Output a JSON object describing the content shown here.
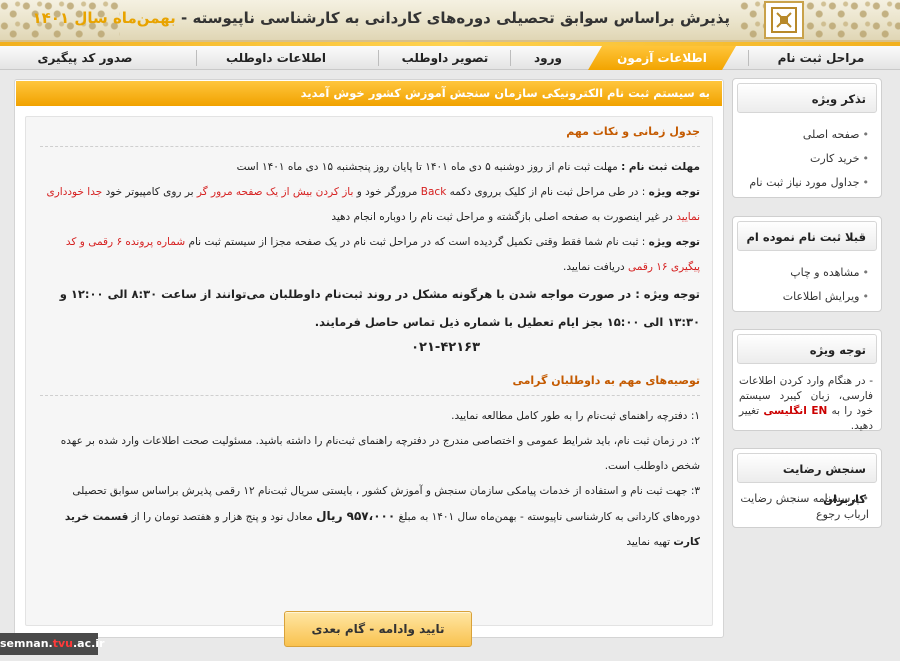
{
  "header": {
    "title": "پذیرش براساس سوابق تحصیلی دوره‌های کاردانی به کارشناسی ناپیوسته - ",
    "title_year": "بهمن‌ماه سال ۱۴۰۱"
  },
  "nav": {
    "items": [
      {
        "label": "مراحل ثبت نام"
      },
      {
        "label": "اطلاعات آزمون"
      },
      {
        "label": "ورود"
      },
      {
        "label": "تصویر داوطلب"
      },
      {
        "label": "اطلاعات داوطلب"
      },
      {
        "label": "صدور کد پیگیری"
      }
    ],
    "active_index": 1
  },
  "main": {
    "welcome": "به سیستم ثبت نام الکترونیکی سازمان سنجش آموزش کشور خوش آمدید",
    "section1_title": "جدول زمانی و نکات مهم",
    "deadline_label": "مهلت ثبت نام :",
    "deadline_text": " مهلت ثبت نام از روز دوشنبه ۵ دی ماه ۱۴۰۱ تا پایان روز پنجشنبه ۱۵ دی ماه ۱۴۰۱ است",
    "note_label": "توجه ویژه",
    "note1_a": " : در طی مراحل ثبت نام از کلیک برروی دکمه ",
    "note1_back": "Back",
    "note1_b": " مرورگر خود و ",
    "note1_red1": "باز کردن بیش از یک صفحه مرور گر",
    "note1_c": " بر روی کامپیوتر خود ",
    "note1_red2": "جدا خودداری نمایید",
    "note1_d": " در غیر اینصورت به صفحه اصلی بازگشته و مراحل ثبت نام را دوباره انجام دهید",
    "note2_a": " : ثبت نام  شما فقط وقتی تکمیل گردیده است که در مراحل ثبت نام در یک صفحه مجزا از سیستم ثبت نام ",
    "note2_red1": "شماره پرونده  ۶ رقمی",
    "note2_b": " ",
    "note2_red2": "و کد پیگیری ۱۶ رقمی",
    "note2_c": " دریافت نمایید.",
    "note3_text": " : در صورت مواجه شدن با هرگونه مشکل در روند ثبت‌نام داوطلبان می‌توانند از ساعت ۸:۳۰ الی ۱۲:۰۰ و ۱۳:۳۰ الی ۱۵:۰۰ بجز ایام تعطیل با شماره ذیل تماس حاصل فرمایند.",
    "phone": "۰۲۱-۴۲۱۶۳",
    "section2_title": "توصیه‌های مهم به داوطلبان گرامی",
    "rec1": "۱: دفترچه راهنمای ثبت‌نام را به طور کامل مطالعه نمایید.",
    "rec2": "۲: در زمان ثبت نام، باید شرایط عمومی و اختصاصی مندرج در دفترچه راهنمای ثبت‌نام را داشته باشید. مسئولیت صحت اطلاعات وارد شده بر عهده شخص داوطلب است.",
    "rec3_a": "۳: جهت ثبت نام و استفاده از خدمات پیامکی سازمان سنجش و آموزش کشور ، بایستی سریال ثبت‌نام ۱۲ رقمی پذیرش براساس سوابق تحصیلی دوره‌های کاردانی به کارشناسی ناپیوسته - بهمن‌ماه سال ۱۴۰۱ به مبلغ ",
    "rec3_amount": "۹۵۷،۰۰۰ ریال",
    "rec3_b": " معادل نود و پنج هزار و هفتصد تومان را از ",
    "rec3_bold": "قسمت خرید کارت",
    "rec3_c": " تهیه نمایید",
    "continue_button": "تایید وادامه - گام بعدی"
  },
  "sidebar": {
    "box1": {
      "title": "تذکر ویژه",
      "items": [
        "صفحه اصلی",
        "خرید کارت",
        "جداول مورد نیاز ثبت نام"
      ]
    },
    "box2": {
      "title": "قبلا ثبت نام نموده ام",
      "items": [
        "مشاهده و چاپ",
        "ویرایش اطلاعات"
      ]
    },
    "box3": {
      "title": "توجه ویژه",
      "text_a": "- در هنگام وارد کردن اطلاعات فارسی، زبان کیبرد سیستم خود را به ",
      "text_en": "EN انگلیسی",
      "text_b": " تغییر دهید."
    },
    "box4": {
      "title": "سنجش رضایت کاربران",
      "items": [
        "پرسشنامه سنجش رضایت ارباب رجوع"
      ]
    }
  },
  "watermark": {
    "prefix": "semnan.",
    "accent": "tvu",
    "suffix": ".ac.ir"
  },
  "colors": {
    "accent": "#f2a400",
    "red": "#d62020",
    "section_title": "#c45a00"
  }
}
